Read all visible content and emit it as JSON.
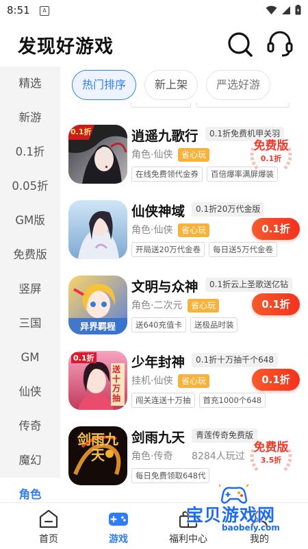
{
  "status_bar": {
    "time": "8:51",
    "notif_glyph": "A"
  },
  "header": {
    "title": "发现好游戏"
  },
  "sidebar": {
    "items": [
      "精选",
      "新游",
      "0.1折",
      "0.05折",
      "GM版",
      "免费版",
      "竖屏",
      "三国",
      "GM",
      "仙侠",
      "传奇",
      "魔幻",
      "角色"
    ],
    "active": "角色"
  },
  "tabs": [
    "热门排序",
    "新上架",
    "严选好游"
  ],
  "games": [
    {
      "title": "逍遥九歌行",
      "promo": "0.1折免费机甲关羽",
      "category": "角色·仙侠",
      "badge": "省心玩",
      "tags": [
        "在线免费领代金券",
        "百倍爆率满屏爆装"
      ],
      "offer_type": "free",
      "offer_main": "免费版",
      "offer_sub": "0.1折",
      "icon_label": "0.1折"
    },
    {
      "title": "仙侠神域",
      "promo": "0.1折20万代金版",
      "category": "角色·仙侠",
      "badge": "省心玩",
      "tags": [
        "开局送20万代金卷",
        "每日送5万代金卷"
      ],
      "offer_type": "discount",
      "offer_main": "0.1折"
    },
    {
      "title": "文明与众神",
      "promo": "0.1折云上圣歌送亿钻",
      "category": "角色·二次元",
      "badge": "省心玩",
      "tags": [
        "送640充值卡",
        "送极品时装"
      ],
      "offer_type": "discount",
      "offer_main": "0.1折",
      "icon_label": "异界羁程"
    },
    {
      "title": "少年封神",
      "promo": "0.1折十万抽千个648",
      "category": "挂机·仙侠",
      "badge": "省心玩",
      "tags": [
        "闯关连送十万抽",
        "首充1000个648"
      ],
      "offer_type": "discount",
      "offer_main": "0.1折",
      "icon_label": "0.1折",
      "icon_side": "送十万抽"
    },
    {
      "title": "剑雨九天",
      "promo": "青莲传奇免费版",
      "category": "角色·传奇",
      "players": "8284人玩过",
      "tags": [
        "每日免费领取648代"
      ],
      "offer_type": "free",
      "offer_main": "免费版",
      "offer_sub": "3.5折",
      "icon_label": "剑雨九天"
    }
  ],
  "tabbar": {
    "items": [
      {
        "label": "首页",
        "icon": "home-icon"
      },
      {
        "label": "游戏",
        "icon": "gamepad-icon"
      },
      {
        "label": "福利中心",
        "icon": "gift-icon"
      },
      {
        "label": "我的",
        "icon": "user-icon"
      }
    ],
    "active": "游戏"
  },
  "watermark": {
    "text": "宝贝游戏网",
    "url": "baobeiy.com"
  },
  "colors": {
    "accent": "#2f7cf6",
    "discount": "#f4321e",
    "badge": "#f6b23a",
    "sidebar_bg": "#f4f4f4"
  }
}
